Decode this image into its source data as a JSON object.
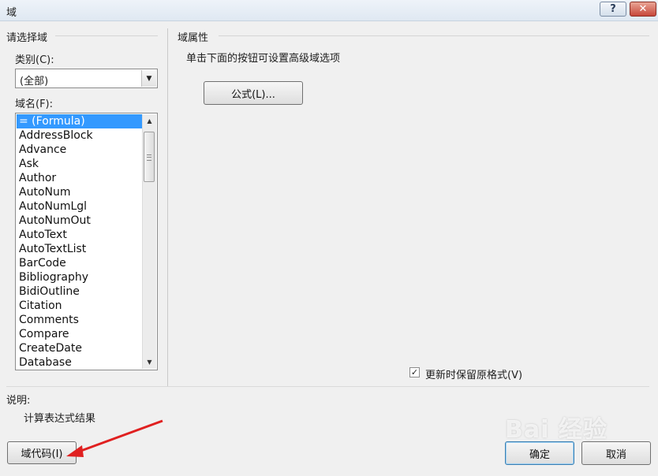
{
  "window": {
    "title": "域",
    "help_label": "?",
    "close_label": "✕"
  },
  "left_panel": {
    "group_title": "请选择域",
    "category_label": "类别(C):",
    "category_value": "(全部)",
    "field_names_label": "域名(F):",
    "field_names": [
      "= (Formula)",
      "AddressBlock",
      "Advance",
      "Ask",
      "Author",
      "AutoNum",
      "AutoNumLgl",
      "AutoNumOut",
      "AutoText",
      "AutoTextList",
      "BarCode",
      "Bibliography",
      "BidiOutline",
      "Citation",
      "Comments",
      "Compare",
      "CreateDate",
      "Database"
    ],
    "selected_field": "= (Formula)"
  },
  "right_panel": {
    "group_title": "域属性",
    "instruction": "单击下面的按钮可设置高级域选项",
    "formula_button": "公式(L)...",
    "preserve_format_label": "更新时保留原格式(V)",
    "preserve_format_checked": true
  },
  "description": {
    "label": "说明:",
    "text": "计算表达式结果"
  },
  "buttons": {
    "field_codes": "域代码(I)",
    "ok": "确定",
    "cancel": "取消"
  },
  "watermark": "Bai 经验",
  "colors": {
    "selection": "#3399ff",
    "annotation_arrow": "#e02020"
  }
}
